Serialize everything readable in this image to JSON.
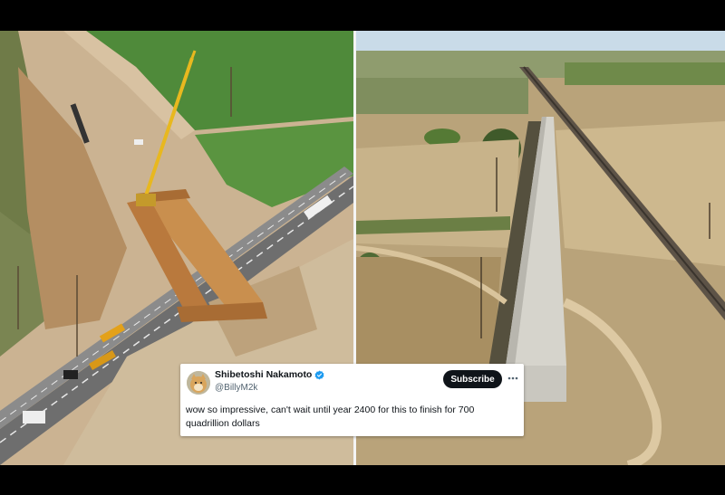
{
  "tweet": {
    "author_name": "Shibetoshi Nakamoto",
    "handle": "@BillyM2k",
    "subscribe_label": "Subscribe",
    "more_icon": "more-horizontal-icon",
    "text": "wow so impressive, can't wait until year 2400 for this to finish for 700 quadrillion dollars",
    "verified_icon": "verified-badge-icon",
    "avatar_icon": "shiba-avatar"
  },
  "colors": {
    "verified_blue": "#1d9bf0",
    "subscribe_bg": "#0f1419",
    "field_green": "#4f8a3a",
    "dirt": "#c7a57c",
    "sky": "#c9dbe8"
  }
}
